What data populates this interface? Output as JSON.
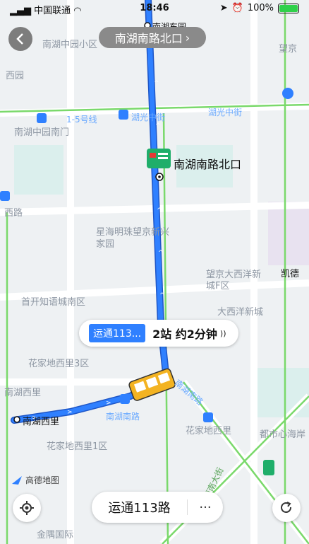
{
  "status_bar": {
    "carrier": "中国联通",
    "time": "18:46",
    "battery": "100%"
  },
  "header": {
    "route_title": "南湖南路北口"
  },
  "map": {
    "current_stop": "南湖南路北口",
    "start_stop": "南湖西里",
    "top_stop": "南湖东园",
    "place_labels": [
      "南湖中园小区",
      "望京",
      "西园",
      "南湖中园南门",
      "湖光中街",
      "湖光中街",
      "1-5号线",
      "星海明珠望京新兴家园",
      "望京大西洋新城F区",
      "大西洋新城",
      "首开知语城南区",
      "花家地西里3区",
      "南湖西里",
      "南湖南路",
      "花家地西里",
      "花家地西里1区",
      "都市心海岸",
      "南湖南路",
      "凯德",
      "西路",
      "金隅国际",
      "广顺南大街"
    ]
  },
  "callout": {
    "route_badge": "运通113...",
    "eta_text": "2站 约2分钟"
  },
  "bottom_bar": {
    "route_name": "运通113路",
    "more_label": "···"
  },
  "logo": {
    "text": "高德地图"
  },
  "colors": {
    "route_blue": "#2f80ff",
    "road_green": "#7ad96b",
    "map_bg": "#eef1f3"
  }
}
